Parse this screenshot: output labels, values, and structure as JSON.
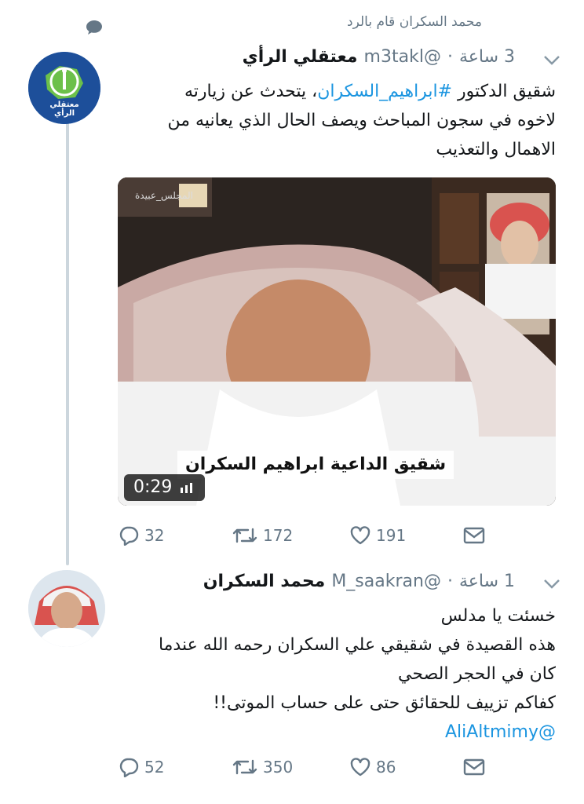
{
  "reply_context": "محمد السكران قام بالرد",
  "tweets": [
    {
      "name": "معتقلي الرأي",
      "handle": "@m3takl",
      "time": "3 ساعة",
      "text_lines": [
        "شقيق الدكتور #ابراهيم_السكران، يتحدث عن زيارته",
        "لاخوه في سجون المباحث ويصف الحال الذي يعانيه من",
        "الاهمال والتعذيب"
      ],
      "hashtag": "#ابراهيم_السكران",
      "video": {
        "duration": "0:29",
        "caption": "شقيق الداعية ابراهيم السكران",
        "watermark": "المجلس_عبيدة"
      },
      "avatar_text": "معتقلي الرأي",
      "replies": "32",
      "retweets": "172",
      "likes": "191"
    },
    {
      "name": "محمد السكران",
      "handle": "@M_saakran",
      "time": "1 ساعة",
      "text_lines": [
        "خسئت يا مدلس",
        "هذه القصيدة في شقيقي علي السكران رحمه الله عندما",
        "كان في الحجر الصحي",
        "كفاكم تزييف للحقائق حتى على حساب الموتى!!"
      ],
      "mention": "@AliAltmimy",
      "replies": "52",
      "retweets": "350",
      "likes": "86"
    }
  ],
  "colors": {
    "link": "#1b95e0",
    "muted": "#657786",
    "text": "#14171a"
  },
  "icons": [
    "speech-bubble-icon",
    "chevron-down-icon",
    "reply-icon",
    "retweet-icon",
    "like-icon",
    "message-icon",
    "volume-icon"
  ]
}
